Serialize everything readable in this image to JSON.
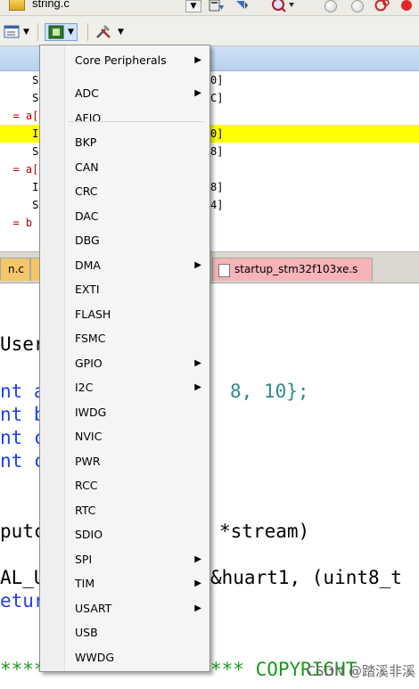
{
  "toolbar": {
    "file_name": "string.c"
  },
  "code_top": {
    "lines": [
      {
        "left": "     S",
        "right": "0]"
      },
      {
        "left": "     S",
        "right": "C]"
      },
      {
        "left": "  = a[",
        "right": ""
      },
      {
        "left": "     I",
        "right": "0]"
      },
      {
        "left": "     S",
        "right": "8]"
      },
      {
        "left": "  = a[",
        "right": ""
      },
      {
        "left": "     I",
        "right": "8]"
      },
      {
        "left": "     S",
        "right": "4]"
      },
      {
        "left": "  = b",
        "right": ""
      }
    ]
  },
  "tabs": {
    "main": "n.c",
    "startup": "startup_stm32f103xe.s"
  },
  "code": {
    "l1": "User",
    "l2a": "nt a",
    "l2b": "8, 10};",
    "l3": "nt b",
    "l4": "nt c",
    "l5": "nt c",
    "l6a": "putc",
    "l6b": "*stream)",
    "l7a": "AL_U",
    "l7b": "&huart1, (uint8_t",
    "l8": "etur",
    "l9a": "****",
    "l9b": "*** COPYRIGHT"
  },
  "watermark": "CSDN @踏溪非溪",
  "menu": {
    "header": {
      "label": "Core Peripherals",
      "has_submenu": true
    },
    "items": [
      {
        "label": "ADC",
        "has_submenu": true
      },
      {
        "label": "AFIO",
        "has_submenu": false
      },
      {
        "label": "BKP",
        "has_submenu": false
      },
      {
        "label": "CAN",
        "has_submenu": false
      },
      {
        "label": "CRC",
        "has_submenu": false
      },
      {
        "label": "DAC",
        "has_submenu": false
      },
      {
        "label": "DBG",
        "has_submenu": false
      },
      {
        "label": "DMA",
        "has_submenu": true
      },
      {
        "label": "EXTI",
        "has_submenu": false
      },
      {
        "label": "FLASH",
        "has_submenu": false
      },
      {
        "label": "FSMC",
        "has_submenu": false
      },
      {
        "label": "GPIO",
        "has_submenu": true
      },
      {
        "label": "I2C",
        "has_submenu": true
      },
      {
        "label": "IWDG",
        "has_submenu": false
      },
      {
        "label": "NVIC",
        "has_submenu": false
      },
      {
        "label": "PWR",
        "has_submenu": false
      },
      {
        "label": "RCC",
        "has_submenu": false
      },
      {
        "label": "RTC",
        "has_submenu": false
      },
      {
        "label": "SDIO",
        "has_submenu": false
      },
      {
        "label": "SPI",
        "has_submenu": true
      },
      {
        "label": "TIM",
        "has_submenu": true
      },
      {
        "label": "USART",
        "has_submenu": true
      },
      {
        "label": "USB",
        "has_submenu": false
      },
      {
        "label": "WWDG",
        "has_submenu": false
      }
    ]
  },
  "colors": {
    "highlight_line": "#ffff00",
    "code_blue": "#1f3fe8",
    "code_number": "#2e8b8b",
    "comment_green": "#1a9a1a",
    "startup_tab": "#f7b3b8",
    "main_tab": "#f3c769"
  },
  "icons": [
    "file-icon",
    "combo-dropdown-icon",
    "find-in-files-icon",
    "zoom-icon",
    "breakpoint-icon",
    "peripheral-window-icon",
    "tools-icon",
    "chevron-down-icon",
    "submenu-arrow-icon"
  ]
}
